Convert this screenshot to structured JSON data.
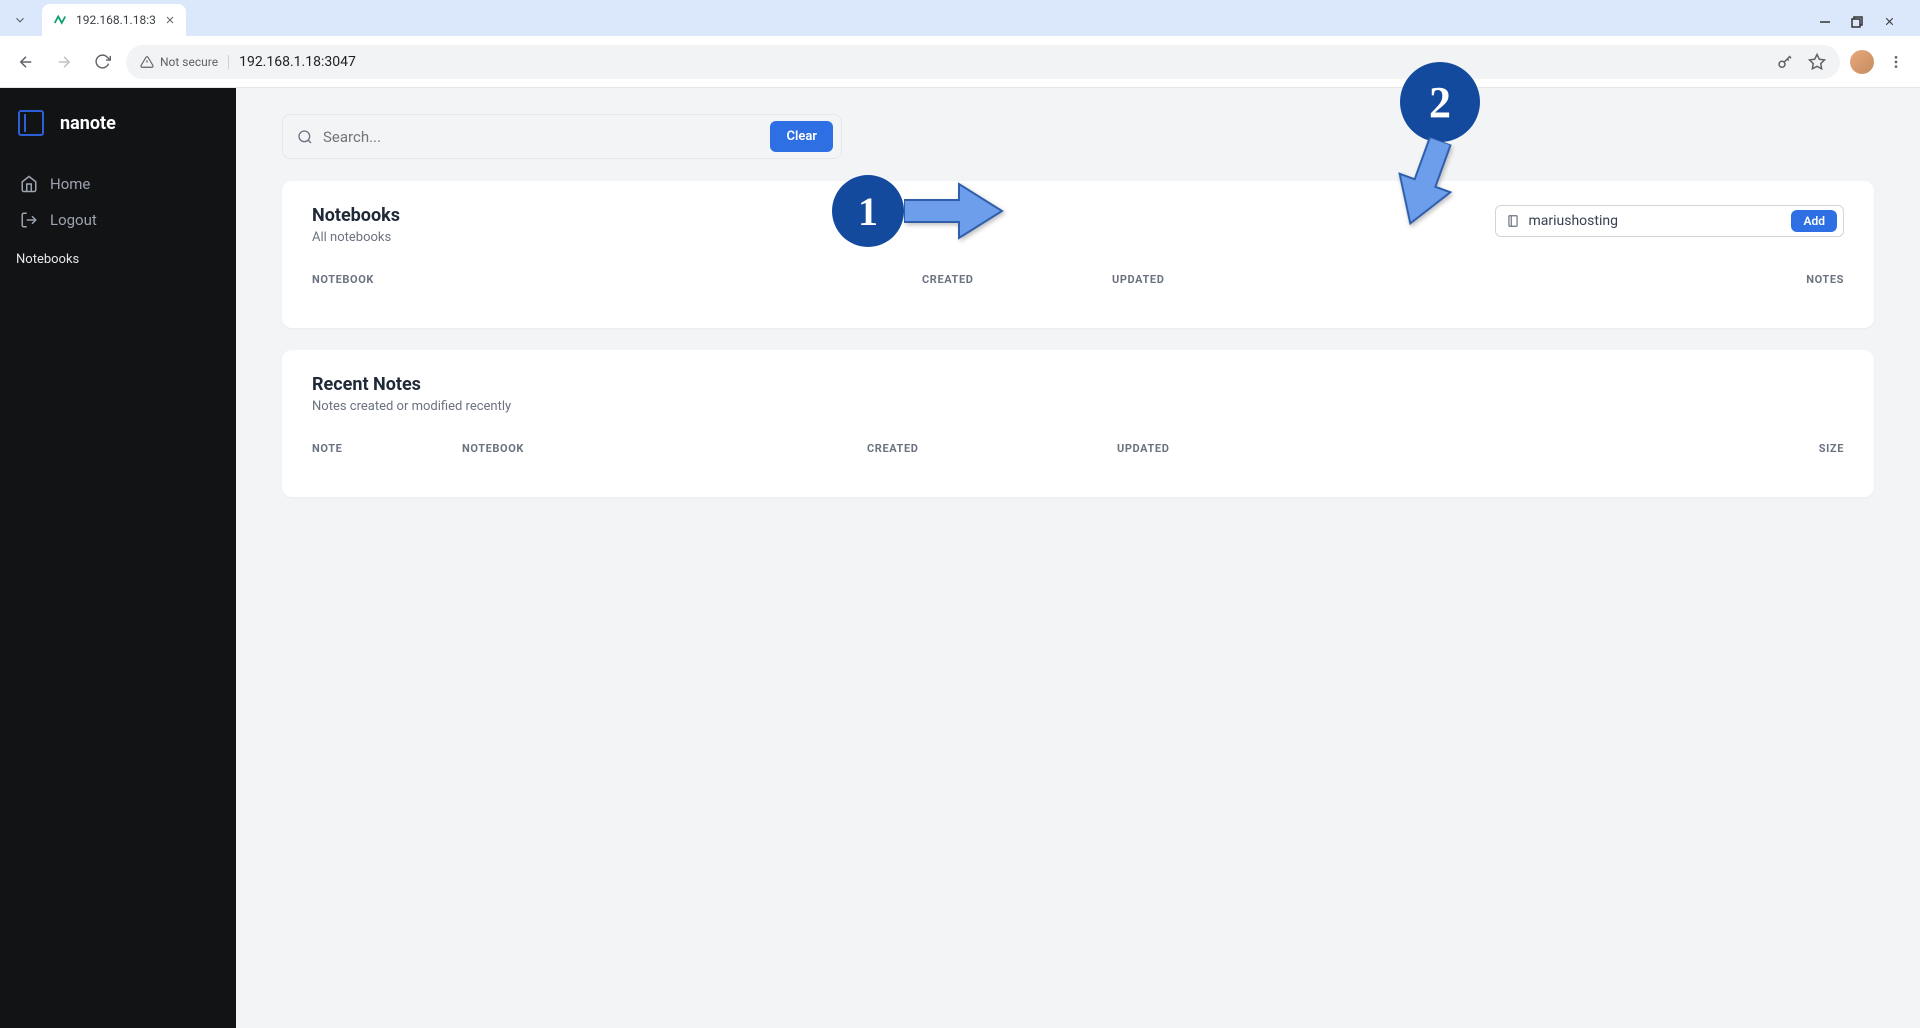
{
  "browser": {
    "tab_title": "192.168.1.18:3",
    "url": "192.168.1.18:3047",
    "security_label": "Not secure"
  },
  "sidebar": {
    "brand": "nanote",
    "items": [
      {
        "label": "Home"
      },
      {
        "label": "Logout"
      }
    ],
    "section_label": "Notebooks"
  },
  "search": {
    "placeholder": "Search...",
    "clear_label": "Clear"
  },
  "notebooks_card": {
    "title": "Notebooks",
    "subtitle": "All notebooks",
    "input_value": "mariushosting",
    "add_label": "Add",
    "columns": {
      "notebook": "NOTEBOOK",
      "created": "CREATED",
      "updated": "UPDATED",
      "notes": "NOTES"
    }
  },
  "recent_card": {
    "title": "Recent Notes",
    "subtitle": "Notes created or modified recently",
    "columns": {
      "note": "NOTE",
      "notebook": "NOTEBOOK",
      "created": "CREATED",
      "updated": "UPDATED",
      "size": "SIZE"
    }
  },
  "annotations": {
    "one": "1",
    "two": "2"
  }
}
